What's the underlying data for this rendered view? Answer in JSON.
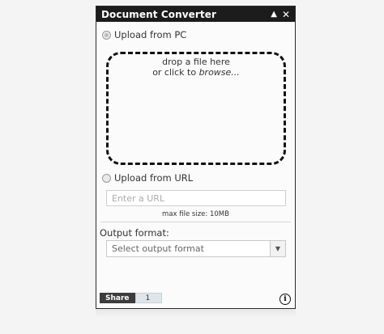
{
  "window": {
    "title": "Document Converter",
    "minimize_icon": "triangle-up-icon",
    "close_icon": "close-icon"
  },
  "upload_pc": {
    "label": "Upload from PC",
    "selected": true,
    "dropzone_line1": "drop a file here",
    "dropzone_line2_prefix": "or click to ",
    "dropzone_line2_link": "browse..."
  },
  "upload_url": {
    "label": "Upload from URL",
    "selected": false,
    "placeholder": "Enter a URL",
    "max_size": "max file size: 10MB"
  },
  "output": {
    "label": "Output format:",
    "selected": "Select output format"
  },
  "footer": {
    "share_label": "Share",
    "share_count": "1",
    "info_icon": "info-icon"
  }
}
